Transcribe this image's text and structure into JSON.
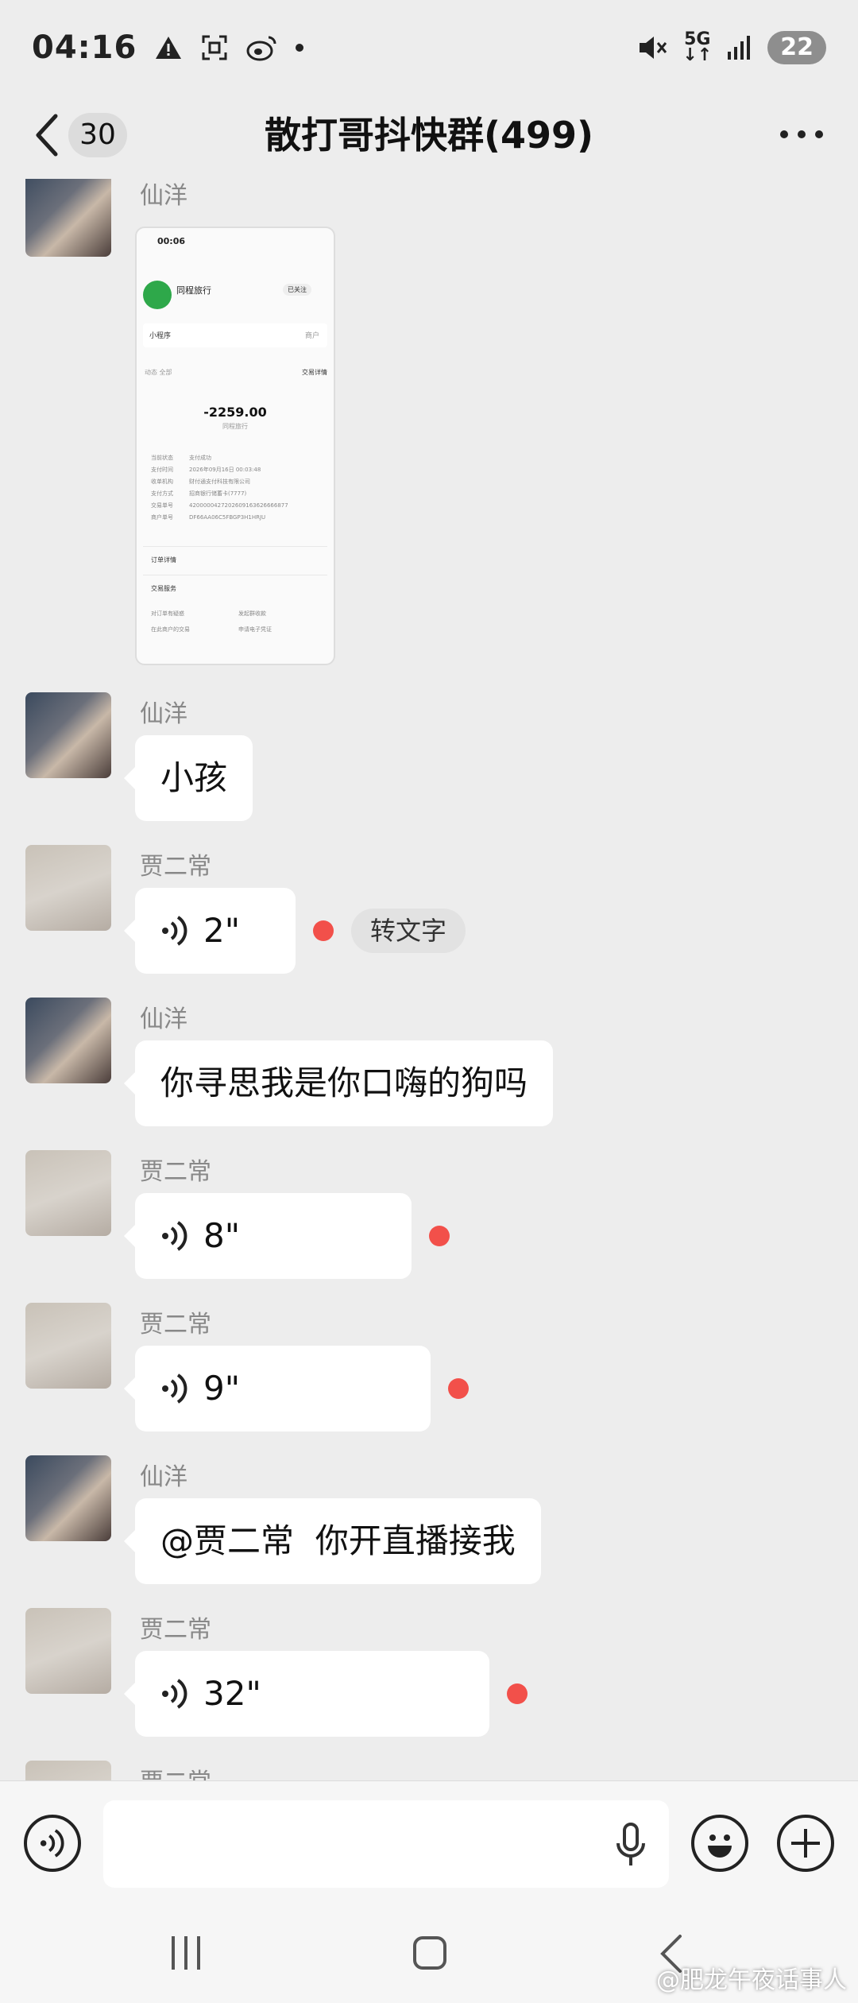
{
  "status_bar": {
    "time": "04:16",
    "signal_label": "5G",
    "battery": "22"
  },
  "header": {
    "unread_count": "30",
    "title": "散打哥抖快群(499)"
  },
  "messages": [
    {
      "sender": "仙洋",
      "type": "image",
      "image": {
        "status_time": "00:06",
        "merchant_name": "同程旅行",
        "follow_label": "已关注",
        "mini_program": "小程序",
        "mini_program_right": "商户",
        "tabs": "动态  全部",
        "detail_label": "交易详情",
        "amount": "-2259.00",
        "merchant_sub": "同程旅行",
        "rows": [
          {
            "k": "当前状态",
            "v": "支付成功"
          },
          {
            "k": "支付时间",
            "v": "2026年09月16日 00:03:48"
          },
          {
            "k": "收单机构",
            "v": "财付通支付科技有限公司"
          },
          {
            "k": "支付方式",
            "v": "招商银行储蓄卡(7777)"
          },
          {
            "k": "交易单号",
            "v": "4200000427202609163626666877"
          },
          {
            "k": "商户单号",
            "v": "DF66AA06C5FBGP3H1HRJU"
          }
        ],
        "order_section": "订单详情",
        "service_section": "交易服务",
        "service_items": [
          "对订单有疑惑",
          "发起群收款",
          "在此商户的交易",
          "申请电子凭证"
        ]
      }
    },
    {
      "sender": "仙洋",
      "type": "text",
      "text": "小孩"
    },
    {
      "sender": "贾二常",
      "type": "voice",
      "duration": "2\"",
      "to_text": "转文字"
    },
    {
      "sender": "仙洋",
      "type": "text",
      "text": "你寻思我是你口嗨的狗吗"
    },
    {
      "sender": "贾二常",
      "type": "voice",
      "duration": "8\""
    },
    {
      "sender": "贾二常",
      "type": "voice",
      "duration": "9\""
    },
    {
      "sender": "仙洋",
      "type": "text",
      "text": "@贾二常  你开直播接我"
    },
    {
      "sender": "贾二常",
      "type": "voice",
      "duration": "32\""
    },
    {
      "sender": "贾二常",
      "type": "partial"
    }
  ],
  "input": {
    "value": "",
    "placeholder": ""
  },
  "watermark": "@肥龙午夜话事人",
  "colors": {
    "background": "#ededed",
    "bubble": "#ffffff",
    "unread_dot": "#f2504a"
  },
  "icons": [
    "warning-icon",
    "screenshot-icon",
    "weibo-icon",
    "mute-icon",
    "signal-icon",
    "back-arrow-icon",
    "more-icon",
    "voice-wave-icon",
    "keyboard-voice-icon",
    "mic-icon",
    "emoji-icon",
    "plus-icon",
    "recent-apps-icon",
    "home-icon",
    "nav-back-icon"
  ]
}
